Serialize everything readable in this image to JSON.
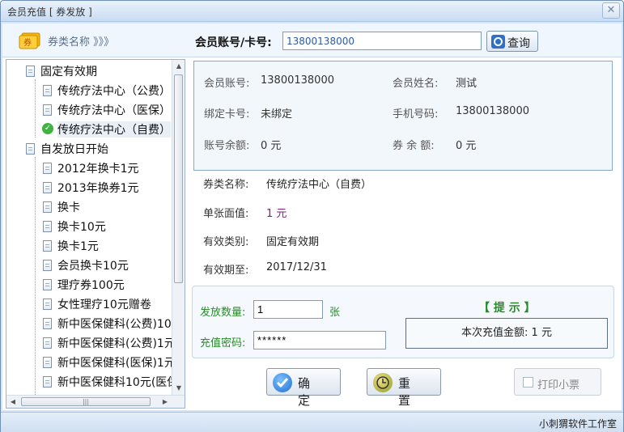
{
  "window": {
    "title": "会员充值 [ 券发放 ]",
    "close": "✕"
  },
  "topbar": {
    "category_title": "券类名称 》》》",
    "account_label": "会员账号/卡号:",
    "account_value": "13800138000",
    "query_label": "查询"
  },
  "tree": {
    "groups": [
      {
        "label": "固定有效期",
        "children": [
          "传统疗法中心（公费）",
          "传统疗法中心（医保）",
          "传统疗法中心（自费）"
        ]
      },
      {
        "label": "自发放日开始",
        "children": [
          "2012年换卡1元",
          "2013年换券1元",
          "换卡",
          "换卡10元",
          "换卡1元",
          "会员换卡10元",
          "理疗券100元",
          "女性理疗10元赠卷",
          "新中医保健科(公费)10",
          "新中医保健科(公费)1元",
          "新中医保健科(医保)1元",
          "新中医保健科10元(医保"
        ]
      }
    ],
    "selected": "传统疗法中心（自费）",
    "hscroll_grip": "|||"
  },
  "member": {
    "account_label": "会员账号:",
    "account_value": "13800138000",
    "name_label": "会员姓名:",
    "name_value": "测试",
    "card_label": "绑定卡号:",
    "card_value": "未绑定",
    "phone_label": "手机号码:",
    "phone_value": "13800138000",
    "balance_label": "账号余额:",
    "balance_value": "0 元",
    "coupon_balance_label": "券 余 额:",
    "coupon_balance_value": "0 元"
  },
  "coupon": {
    "name_label": "券类名称:",
    "name_value": "传统疗法中心（自费）",
    "face_label": "单张面值:",
    "face_value": "1 元",
    "type_label": "有效类别:",
    "type_value": "固定有效期",
    "expiry_label": "有效期至:",
    "expiry_value": "2017/12/31"
  },
  "issue": {
    "qty_label": "发放数量:",
    "qty_value": "1",
    "qty_unit": "张",
    "pwd_label": "充值密码:",
    "pwd_value": "******",
    "tip_title": "【 提  示 】",
    "tip_text": "本次充值金额: 1 元"
  },
  "buttons": {
    "confirm": "确 定",
    "reset": "重 置",
    "print": "打印小票"
  },
  "status": {
    "text": "小刺猬软件工作室"
  }
}
